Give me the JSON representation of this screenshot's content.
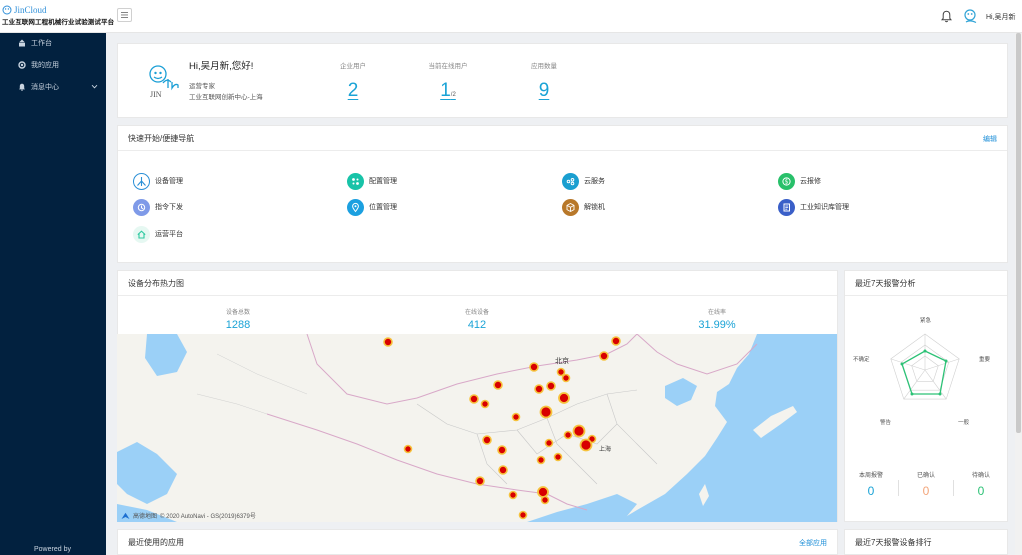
{
  "brand": {
    "name": "JinCloud",
    "subtitle": "工业互联网工程机械行业试验测试平台"
  },
  "header": {
    "menu_icon": "menu-icon",
    "user_name": "Hi,吴月新"
  },
  "sidebar": {
    "items": [
      {
        "label": "工作台",
        "icon": "workbench-icon"
      },
      {
        "label": "我的应用",
        "icon": "app-icon"
      },
      {
        "label": "消息中心",
        "icon": "bell-icon"
      }
    ],
    "powered": "Powered by"
  },
  "welcome": {
    "greeting": "Hi,吴月新,您好!",
    "role": "运营专家",
    "org": "工业互联网创新中心-上海",
    "stats": [
      {
        "label": "企业用户",
        "value": "2",
        "sub": ""
      },
      {
        "label": "当前在线用户",
        "value": "1",
        "sub": "/2"
      },
      {
        "label": "应用数量",
        "value": "9",
        "sub": ""
      }
    ]
  },
  "quicknav": {
    "title": "快速开始/便捷导航",
    "edit": "编辑",
    "items": [
      {
        "label": "设备管理",
        "color": "#2a8fd6"
      },
      {
        "label": "配置管理",
        "color": "#18c3a8"
      },
      {
        "label": "云服务",
        "color": "#1a9fd0"
      },
      {
        "label": "云报修",
        "color": "#28c06a"
      },
      {
        "label": "指令下发",
        "color": "#6c8fe6"
      },
      {
        "label": "位置管理",
        "color": "#1ca0e0"
      },
      {
        "label": "解锁机",
        "color": "#b8782a"
      },
      {
        "label": "工业知识库管理",
        "color": "#3a5fc8"
      },
      {
        "label": "运营平台",
        "color": "#2cc9a0"
      }
    ]
  },
  "heatmap": {
    "title": "设备分布热力图",
    "stats": [
      {
        "label": "设备总数",
        "value": "1288"
      },
      {
        "label": "在线设备",
        "value": "412"
      },
      {
        "label": "在线率",
        "value": "31.99%"
      }
    ],
    "map_labels": {
      "beijing": "北京",
      "shanghai": "上海"
    },
    "credit_logo": "高德地图",
    "credit": "© 2020 AutoNavi - GS(2019)6379号"
  },
  "alarm": {
    "title": "最近7天报警分析",
    "radar_labels": [
      "紧急",
      "重要",
      "一般",
      "警告",
      "不确定"
    ],
    "weekly": [
      {
        "label": "本周报警",
        "value": "0",
        "color": "#1aa3d6"
      },
      {
        "label": "已确认",
        "value": "0",
        "color": "#f3a57a"
      },
      {
        "label": "待确认",
        "value": "0",
        "color": "#2cc276"
      }
    ]
  },
  "recent_apps": {
    "title": "最近使用的应用",
    "all": "全部应用"
  },
  "device_rank": {
    "title": "最近7天报警设备排行"
  }
}
